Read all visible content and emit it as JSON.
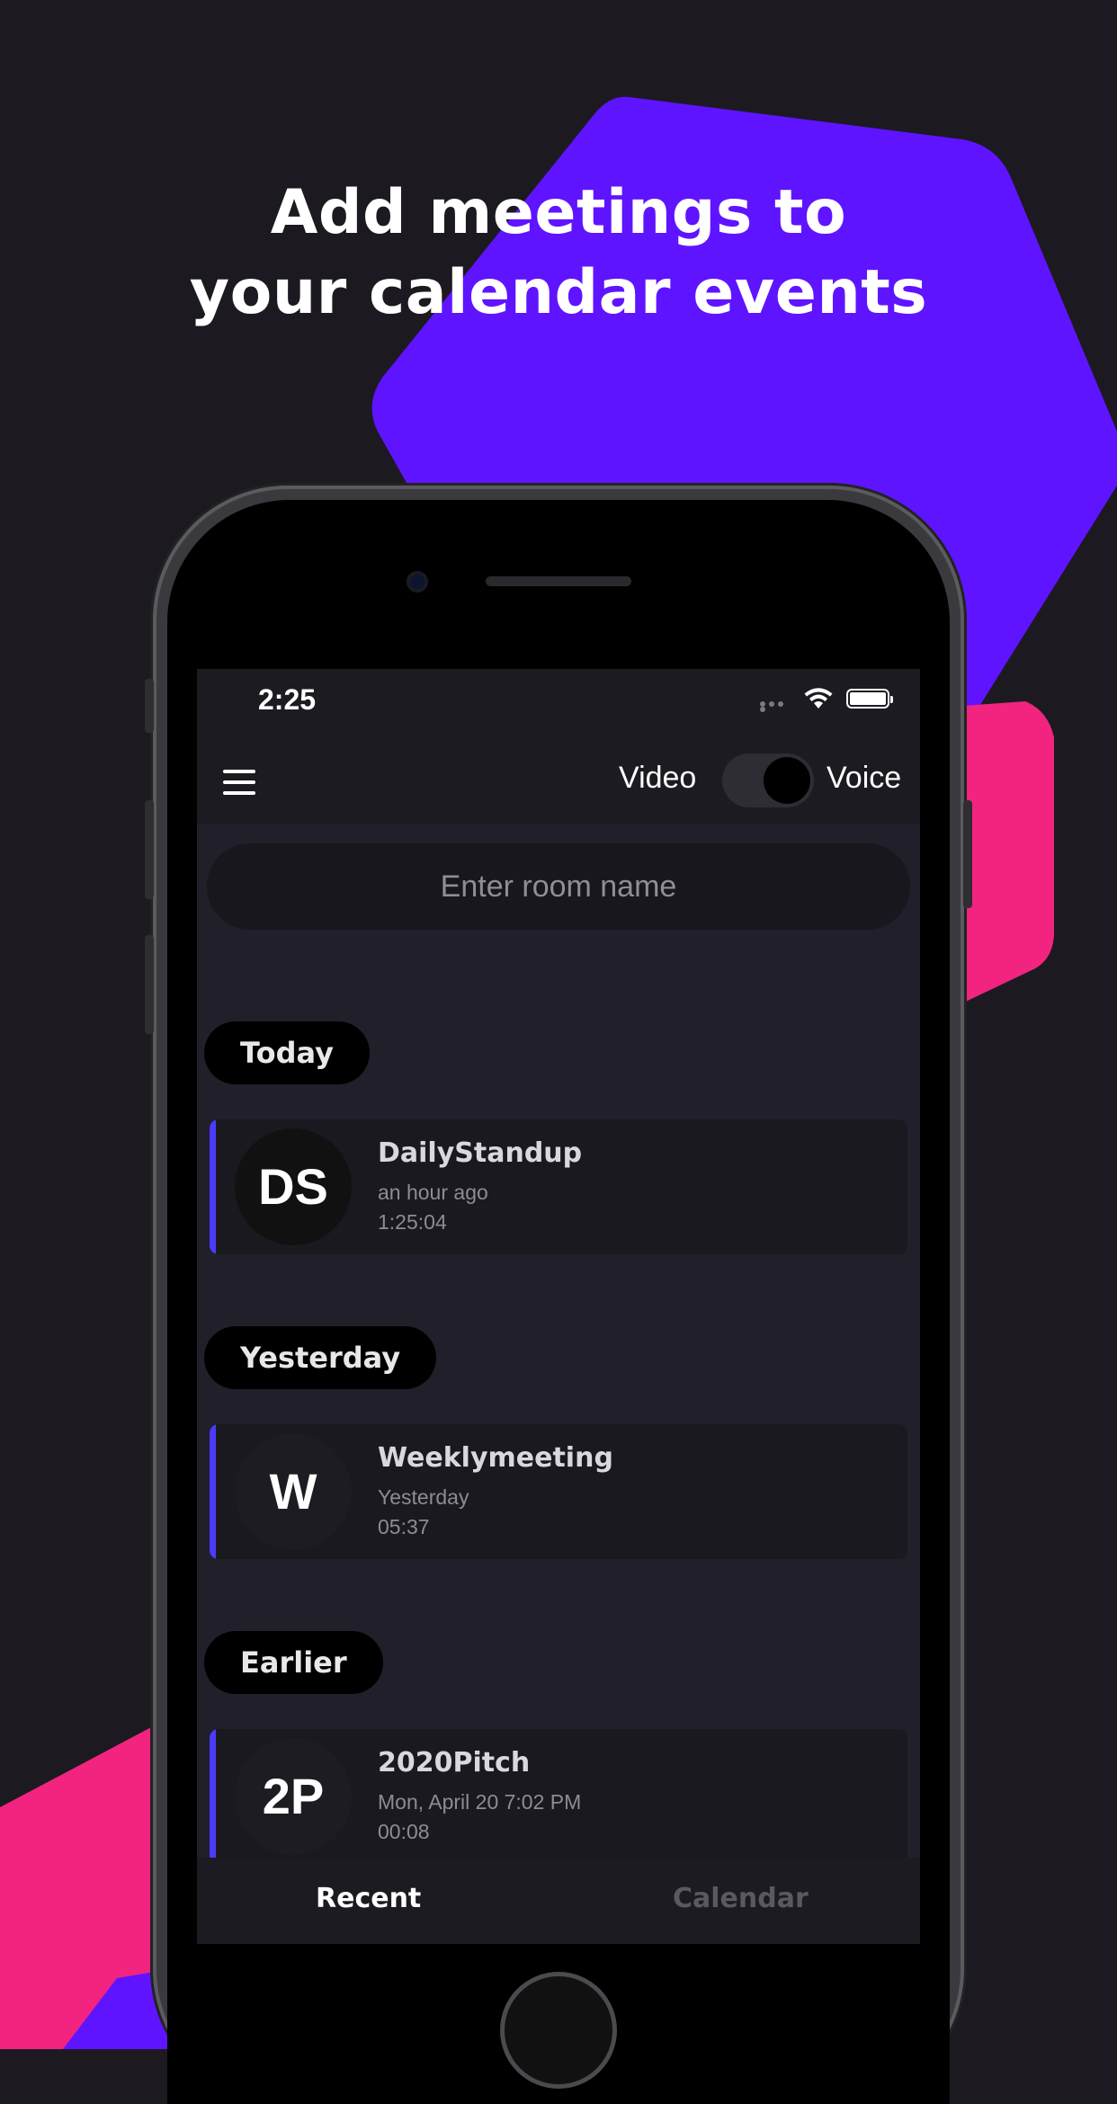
{
  "headline": {
    "line1": "Add meetings to",
    "line2": "your calendar events"
  },
  "colors": {
    "background": "#1c1a20",
    "purple": "#5f14ff",
    "pink": "#f2247f",
    "accent": "#4b3bff"
  },
  "status_bar": {
    "time": "2:25"
  },
  "toolbar": {
    "menu_icon": "hamburger-menu-icon",
    "video_label": "Video",
    "voice_label": "Voice",
    "toggle_state": "voice"
  },
  "search": {
    "placeholder": "Enter room name",
    "value": ""
  },
  "sections": [
    {
      "label": "Today",
      "meetings": [
        {
          "initials": "DS",
          "name": "DailyStandup",
          "when": "an hour ago",
          "duration": "1:25:04"
        }
      ]
    },
    {
      "label": "Yesterday",
      "meetings": [
        {
          "initials": "W",
          "name": "Weeklymeeting",
          "when": "Yesterday",
          "duration": "05:37"
        }
      ]
    },
    {
      "label": "Earlier",
      "meetings": [
        {
          "initials": "2P",
          "name": "2020Pitch",
          "when": "Mon, April 20 7:02 PM",
          "duration": "00:08"
        }
      ]
    }
  ],
  "tabs": {
    "recent": "Recent",
    "calendar": "Calendar",
    "active": "recent"
  }
}
